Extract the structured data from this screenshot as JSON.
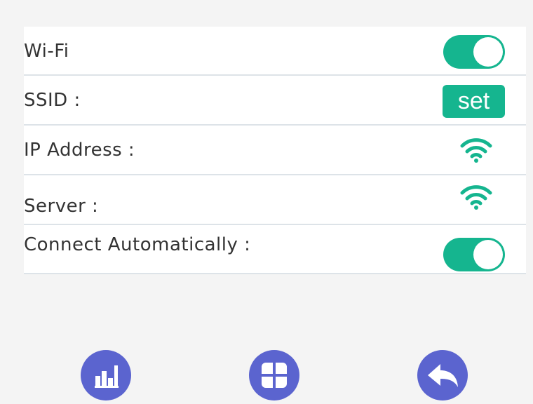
{
  "colors": {
    "accent": "#15b58f",
    "nav": "#5b64cf",
    "background": "#f4f4f4",
    "panel": "#ffffff",
    "divider": "#dde3e8",
    "text": "#333333"
  },
  "settings": {
    "wifi": {
      "label": "Wi-Fi",
      "enabled": true
    },
    "ssid": {
      "label": "SSID :",
      "button_label": "set"
    },
    "ip_address": {
      "label": "IP Address :",
      "icon": "wifi-signal-icon"
    },
    "server": {
      "label": "Server  :",
      "icon": "wifi-signal-icon"
    },
    "connect_auto": {
      "label": "Connect Automatically :",
      "enabled": true
    }
  },
  "nav": {
    "stats_icon": "bar-chart-icon",
    "home_icon": "grid-icon",
    "back_icon": "back-arrow-icon"
  }
}
